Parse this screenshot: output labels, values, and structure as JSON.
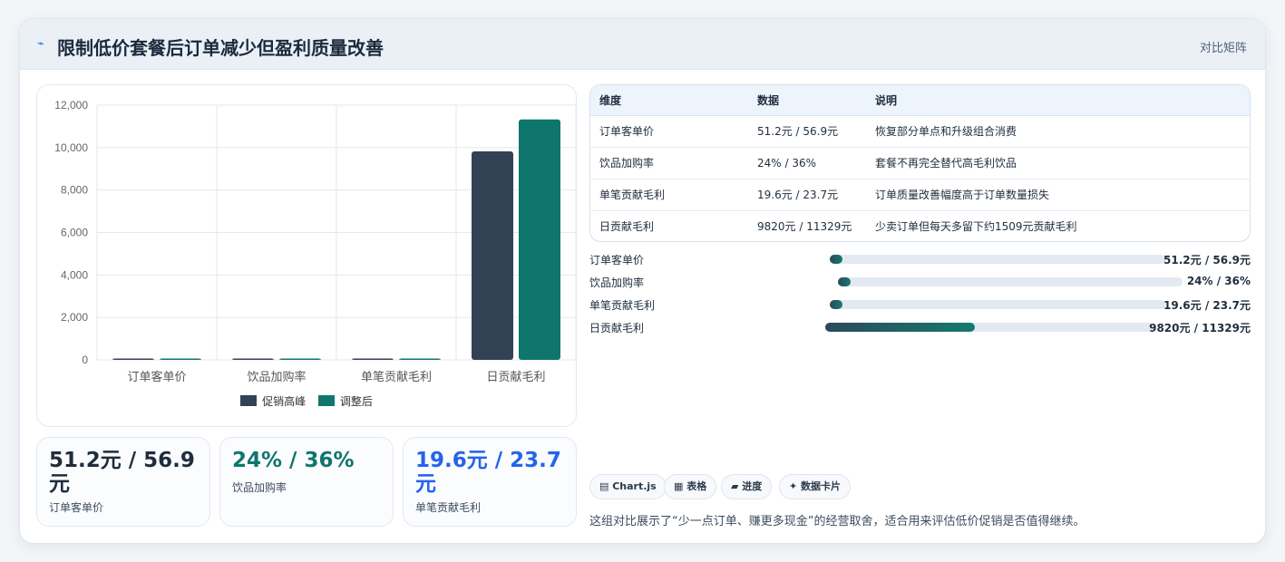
{
  "header": {
    "icon": "sparkle-icon",
    "title": "限制低价套餐后订单减少但盈利质量改善",
    "tag": "对比矩阵"
  },
  "chart_data": {
    "type": "bar",
    "categories": [
      "订单客单价",
      "饮品加购率",
      "单笔贡献毛利",
      "日贡献毛利"
    ],
    "series": [
      {
        "name": "促销高峰",
        "color": "#334155",
        "values": [
          51.2,
          24,
          19.6,
          9820
        ]
      },
      {
        "name": "调整后",
        "color": "#0f766e",
        "values": [
          56.9,
          36,
          23.7,
          11329
        ]
      }
    ],
    "ylim": [
      0,
      12000
    ],
    "yticks": [
      "0",
      "2,000",
      "4,000",
      "6,000",
      "8,000",
      "10,000",
      "12,000"
    ],
    "grid": true,
    "legend": "bottom"
  },
  "kpis": [
    {
      "value": "51.2元 / 56.9元",
      "label": "订单客单价",
      "color": "#1f2d3d"
    },
    {
      "value": "24% / 36%",
      "label": "饮品加购率",
      "color": "#0f766e"
    },
    {
      "value": "19.6元 / 23.7元",
      "label": "单笔贡献毛利",
      "color": "#2563eb"
    }
  ],
  "table": {
    "headers": [
      "维度",
      "数据",
      "说明"
    ],
    "rows": [
      [
        "订单客单价",
        "51.2元 / 56.9元",
        "恢复部分单点和升级组合消费"
      ],
      [
        "饮品加购率",
        "24% / 36%",
        "套餐不再完全替代高毛利饮品"
      ],
      [
        "单笔贡献毛利",
        "19.6元 / 23.7元",
        "订单质量改善幅度高于订单数量损失"
      ],
      [
        "日贡献毛利",
        "9820元 / 11329元",
        "少卖订单但每天多留下约1509元贡献毛利"
      ]
    ]
  },
  "progress": [
    {
      "label": "订单客单价",
      "value": "51.2元 / 56.9元",
      "fraction": 0.038
    },
    {
      "label": "饮品加购率",
      "value": "24% / 36%",
      "fraction": 0.038
    },
    {
      "label": "单笔贡献毛利",
      "value": "19.6元 / 23.7元",
      "fraction": 0.038
    },
    {
      "label": "日贡献毛利",
      "value": "9820元 / 11329元",
      "fraction": 0.455
    }
  ],
  "chips": [
    {
      "icon": "chart-icon",
      "label": "▤ Chart.js"
    },
    {
      "icon": "table-icon",
      "label": "▦ 表格"
    },
    {
      "icon": "progress-icon",
      "label": "▰ 进度"
    },
    {
      "icon": "card-icon",
      "label": "✦ 数据卡片"
    }
  ],
  "footnote": "这组对比展示了“少一点订单、赚更多现金”的经营取舍，适合用来评估低价促销是否值得继续。"
}
